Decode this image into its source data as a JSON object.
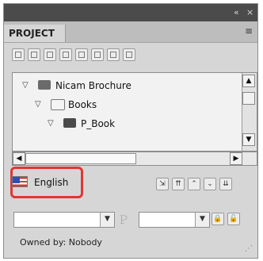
{
  "titlebar": {
    "collapse_icon": "«",
    "close_icon": "×"
  },
  "tabs": [
    {
      "label": "PROJECT"
    }
  ],
  "tab_menu_icon": "≡",
  "toolbar": {
    "buttons": [
      {
        "name": "new-doc-icon"
      },
      {
        "name": "save-icon"
      },
      {
        "name": "package-icon"
      },
      {
        "name": "add-icon"
      },
      {
        "name": "duplicate-icon"
      },
      {
        "name": "delete-icon"
      },
      {
        "name": "properties-icon"
      },
      {
        "name": "refresh-icon"
      }
    ]
  },
  "tree": {
    "items": [
      {
        "label": "Nicam Brochure",
        "icon": "project-folder-icon"
      },
      {
        "label": "Books",
        "icon": "folder-icon"
      },
      {
        "label": "P_Book",
        "icon": "book-icon"
      }
    ]
  },
  "language": {
    "label": "English",
    "flag": "us-flag-icon"
  },
  "owner": {
    "text": "Owned by: Nobody"
  },
  "dropdowns": [
    {
      "name": "publication-dropdown",
      "value": ""
    },
    {
      "name": "layout-dropdown",
      "value": ""
    }
  ],
  "colors": {
    "highlight_border": "#e03636",
    "panel_bg": "#d6d6d6",
    "titlebar_bg": "#4b4b4b"
  }
}
